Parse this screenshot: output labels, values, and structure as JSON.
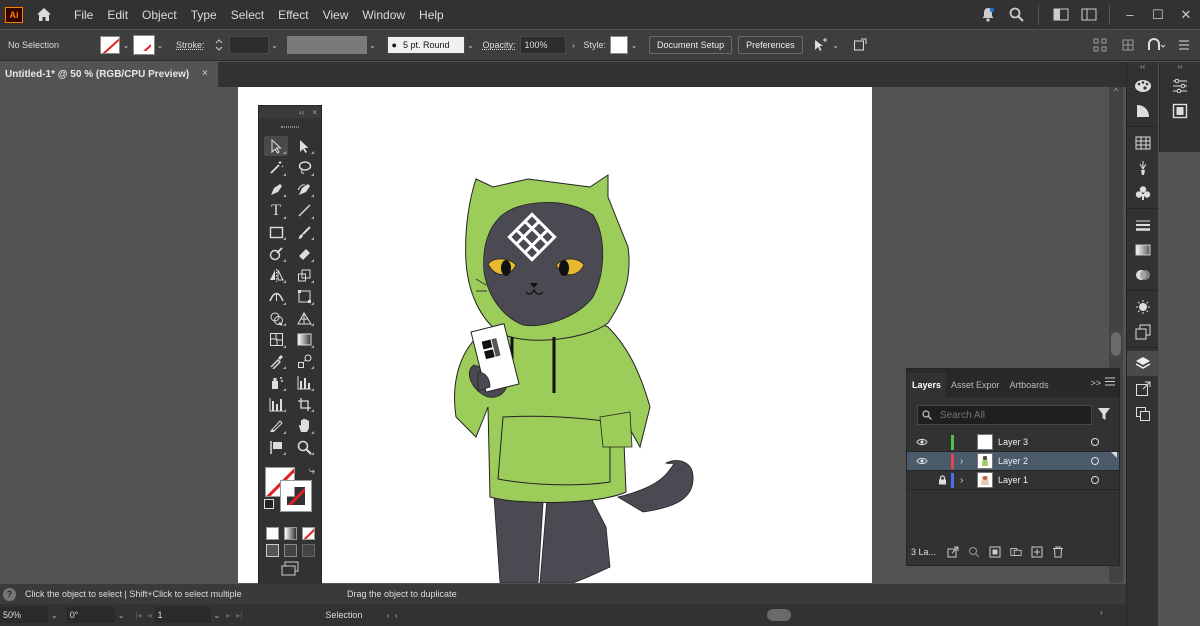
{
  "app": {
    "logo_text": "Ai",
    "menu": [
      "File",
      "Edit",
      "Object",
      "Type",
      "Select",
      "Effect",
      "View",
      "Window",
      "Help"
    ]
  },
  "control_bar": {
    "selection_status": "No Selection",
    "stroke_label": "Stroke:",
    "brush_label": "5 pt. Round",
    "opacity_label": "Opacity:",
    "opacity_value": "100%",
    "style_label": "Style:",
    "document_setup": "Document Setup",
    "preferences": "Preferences"
  },
  "document": {
    "tab_title": "Untitled-1* @ 50 % (RGB/CPU Preview)",
    "close": "×"
  },
  "tools": {
    "head_collapse": "‹‹",
    "head_close": "×",
    "more": "•••"
  },
  "layers_panel": {
    "tabs": [
      "Layers",
      "Asset Expor",
      "Artboards"
    ],
    "more_tabs": ">>",
    "search_placeholder": "Search All",
    "layers": [
      {
        "name": "Layer 3",
        "color": "#4fc24f",
        "visible": true,
        "locked": false,
        "selected": false
      },
      {
        "name": "Layer 2",
        "color": "#e04a4a",
        "visible": true,
        "locked": false,
        "selected": true
      },
      {
        "name": "Layer 1",
        "color": "#4a6cf0",
        "visible": false,
        "locked": true,
        "selected": false
      }
    ],
    "layer_count": "3 La..."
  },
  "status": {
    "hint_left": "Click the object to select  |  Shift+Click to select multiple",
    "hint_right": "Drag the object to duplicate",
    "help_glyph": "?"
  },
  "bottom_bar": {
    "zoom": "50%",
    "rotation": "0°",
    "artboard": "1",
    "tool_name": "Selection"
  },
  "colors": {
    "accent": "#1473e6",
    "hoodie": "#9ccc5a",
    "cat_fur": "#4b4a52",
    "eyes": "#e8b830"
  }
}
